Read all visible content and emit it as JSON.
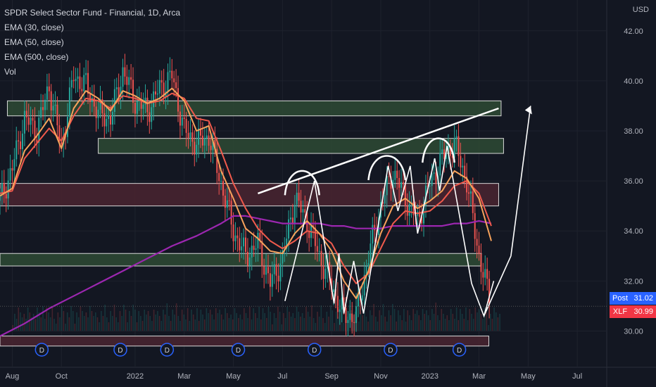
{
  "legend": {
    "title": "SPDR Select Sector Fund - Financial, 1D, Arca",
    "indicators": [
      "EMA (30, close)",
      "EMA (50, close)",
      "EMA (500, close)",
      "Vol"
    ]
  },
  "axis": {
    "currency": "USD"
  },
  "price_labels": {
    "post": {
      "tag": "Post",
      "value": "31.02",
      "color": "#2962ff"
    },
    "last": {
      "tag": "XLF",
      "value": "30.99",
      "color": "#f23645"
    }
  },
  "colors": {
    "background": "#131722",
    "ema30": "#f7a35c",
    "ema50": "#f05a4c",
    "ema500": "#9c27b0",
    "up": "#26a69a",
    "down": "#ef5350",
    "support_zone": "#2e4a34",
    "resistance_zone": "#4a2430",
    "annotation": "#ffffff",
    "dividend_marker": "#2962ff"
  },
  "chart_data": {
    "type": "line",
    "title": "SPDR Select Sector Fund - Financial, 1D, Arca",
    "ylabel": "USD",
    "ylim": [
      29.0,
      42.5
    ],
    "y_ticks": [
      "30.00",
      "32.00",
      "34.00",
      "36.00",
      "38.00",
      "40.00",
      "42.00"
    ],
    "x_ticks": [
      "Aug",
      "Oct",
      "2022",
      "Mar",
      "May",
      "Jul",
      "Sep",
      "Nov",
      "2023",
      "Mar",
      "May",
      "Jul"
    ],
    "x_ticks_month_index": [
      0,
      2,
      5,
      7,
      9,
      11,
      13,
      15,
      17,
      19,
      21,
      23
    ],
    "xlim_month_index": [
      -0.5,
      24.2
    ],
    "series": [
      {
        "name": "EMA (30, close)",
        "x": [
          -0.5,
          0,
          0.5,
          1,
          1.5,
          2,
          2.5,
          3,
          3.5,
          4,
          4.5,
          5,
          5.5,
          6,
          6.5,
          7,
          7.5,
          8,
          8.5,
          9,
          9.5,
          10,
          10.5,
          11,
          11.5,
          12,
          12.5,
          13,
          13.5,
          14,
          14.5,
          15,
          15.5,
          16,
          16.5,
          17,
          17.5,
          18,
          18.5,
          19,
          19.5
        ],
        "values": [
          35.4,
          35.7,
          37.2,
          37.8,
          38.5,
          37.3,
          38.9,
          39.6,
          39.3,
          38.8,
          39.6,
          39.4,
          39.1,
          39.3,
          39.7,
          39.2,
          38.0,
          38.2,
          36.4,
          35.3,
          34.1,
          33.7,
          33.2,
          33.1,
          33.9,
          34.4,
          33.9,
          33.2,
          32.0,
          31.3,
          32.4,
          33.9,
          35.0,
          35.3,
          34.9,
          35.2,
          35.6,
          36.4,
          36.1,
          35.3,
          33.6
        ]
      },
      {
        "name": "EMA (50, close)",
        "x": [
          -0.5,
          0,
          0.5,
          1,
          1.5,
          2,
          2.5,
          3,
          3.5,
          4,
          4.5,
          5,
          5.5,
          6,
          6.5,
          7,
          7.5,
          8,
          8.5,
          9,
          9.5,
          10,
          10.5,
          11,
          11.5,
          12,
          12.5,
          13,
          13.5,
          14,
          14.5,
          15,
          15.5,
          16,
          16.5,
          17,
          17.5,
          18,
          18.5,
          19,
          19.5
        ],
        "values": [
          35.5,
          35.6,
          36.9,
          37.5,
          38.1,
          37.6,
          38.6,
          39.3,
          39.2,
          38.9,
          39.4,
          39.3,
          39.1,
          39.2,
          39.5,
          39.3,
          38.5,
          38.4,
          37.2,
          35.9,
          34.9,
          34.1,
          33.6,
          33.3,
          33.6,
          34.0,
          33.9,
          33.5,
          32.6,
          31.9,
          32.3,
          33.3,
          34.3,
          34.8,
          34.7,
          34.8,
          35.2,
          35.8,
          36.0,
          35.5,
          34.2
        ]
      },
      {
        "name": "EMA (500, close)",
        "x": [
          -0.5,
          0.5,
          1.5,
          2.5,
          3.5,
          4.5,
          5.5,
          6.5,
          7.5,
          8.5,
          9,
          9.5,
          10,
          10.5,
          11,
          11.5,
          12,
          12.5,
          13,
          13.5,
          14,
          14.5,
          15,
          15.5,
          16,
          16.5,
          17,
          17.5,
          18,
          18.5,
          19,
          19.5
        ],
        "values": [
          29.8,
          30.3,
          30.9,
          31.4,
          31.9,
          32.4,
          32.9,
          33.4,
          33.8,
          34.3,
          34.6,
          34.6,
          34.5,
          34.4,
          34.3,
          34.3,
          34.3,
          34.3,
          34.2,
          34.2,
          34.1,
          34.1,
          34.1,
          34.2,
          34.2,
          34.2,
          34.2,
          34.2,
          34.3,
          34.3,
          34.4,
          34.3
        ]
      },
      {
        "name": "Price",
        "x": [
          -0.5,
          0,
          0.5,
          1,
          1.5,
          2,
          2.5,
          3,
          3.5,
          4,
          4.5,
          5,
          5.5,
          6,
          6.5,
          7,
          7.5,
          8,
          8.5,
          9,
          9.5,
          10,
          10.5,
          11,
          11.5,
          12,
          12.5,
          13,
          13.5,
          14,
          14.5,
          15,
          15.5,
          16,
          16.5,
          17,
          17.5,
          18,
          18.5,
          19,
          19.5
        ],
        "values": [
          35.2,
          36.5,
          38.5,
          38.0,
          39.8,
          37.3,
          40.2,
          39.8,
          38.7,
          38.5,
          40.4,
          39.2,
          38.8,
          39.7,
          40.2,
          38.0,
          37.5,
          37.8,
          35.9,
          34.0,
          33.0,
          33.5,
          31.9,
          32.9,
          35.3,
          34.4,
          33.0,
          31.8,
          30.6,
          30.6,
          33.0,
          35.0,
          36.4,
          35.3,
          34.4,
          35.9,
          36.9,
          37.5,
          36.0,
          33.0,
          30.99
        ]
      }
    ],
    "zones": [
      {
        "kind": "support",
        "x": [
          -0.2,
          19.9
        ],
        "y": [
          38.6,
          39.2
        ]
      },
      {
        "kind": "support",
        "x": [
          3.5,
          20.0
        ],
        "y": [
          37.1,
          37.7
        ]
      },
      {
        "kind": "resistance",
        "x": [
          -0.5,
          19.8
        ],
        "y": [
          35.0,
          35.9
        ]
      },
      {
        "kind": "support",
        "x": [
          -0.5,
          19.1
        ],
        "y": [
          32.6,
          33.1
        ]
      },
      {
        "kind": "resistance",
        "x": [
          -0.5,
          19.4
        ],
        "y": [
          29.4,
          29.8
        ]
      }
    ],
    "trendline": {
      "x": [
        10.0,
        19.8
      ],
      "y": [
        35.5,
        38.9
      ]
    },
    "zigzag": {
      "x": [
        11.1,
        12.3,
        13.1,
        13.3,
        13.5,
        13.9,
        14.3,
        15.3,
        15.7,
        16.2,
        16.5,
        17.2,
        17.4,
        17.7,
        18.7,
        19.2,
        19.6
      ],
      "y": [
        31.2,
        36.0,
        31.1,
        33.1,
        30.7,
        32.8,
        30.7,
        36.6,
        34.8,
        36.6,
        33.9,
        36.9,
        35.6,
        37.4,
        31.9,
        30.6,
        32.0
      ]
    },
    "zigzag_projection": {
      "x": [
        19.2,
        20.3,
        21.1
      ],
      "y": [
        30.6,
        33.0,
        39.0
      ]
    },
    "arcs": [
      {
        "x": [
          11.1,
          12.5
        ],
        "peak": 36.5
      },
      {
        "x": [
          14.5,
          16.0
        ],
        "peak": 37.1
      },
      {
        "x": [
          16.7,
          18.0
        ],
        "peak": 37.8
      }
    ],
    "last_price": 30.99,
    "post_price": 31.02,
    "dividend_markers_month_index": [
      1.2,
      4.4,
      6.3,
      9.2,
      12.3,
      15.4,
      18.2
    ]
  }
}
